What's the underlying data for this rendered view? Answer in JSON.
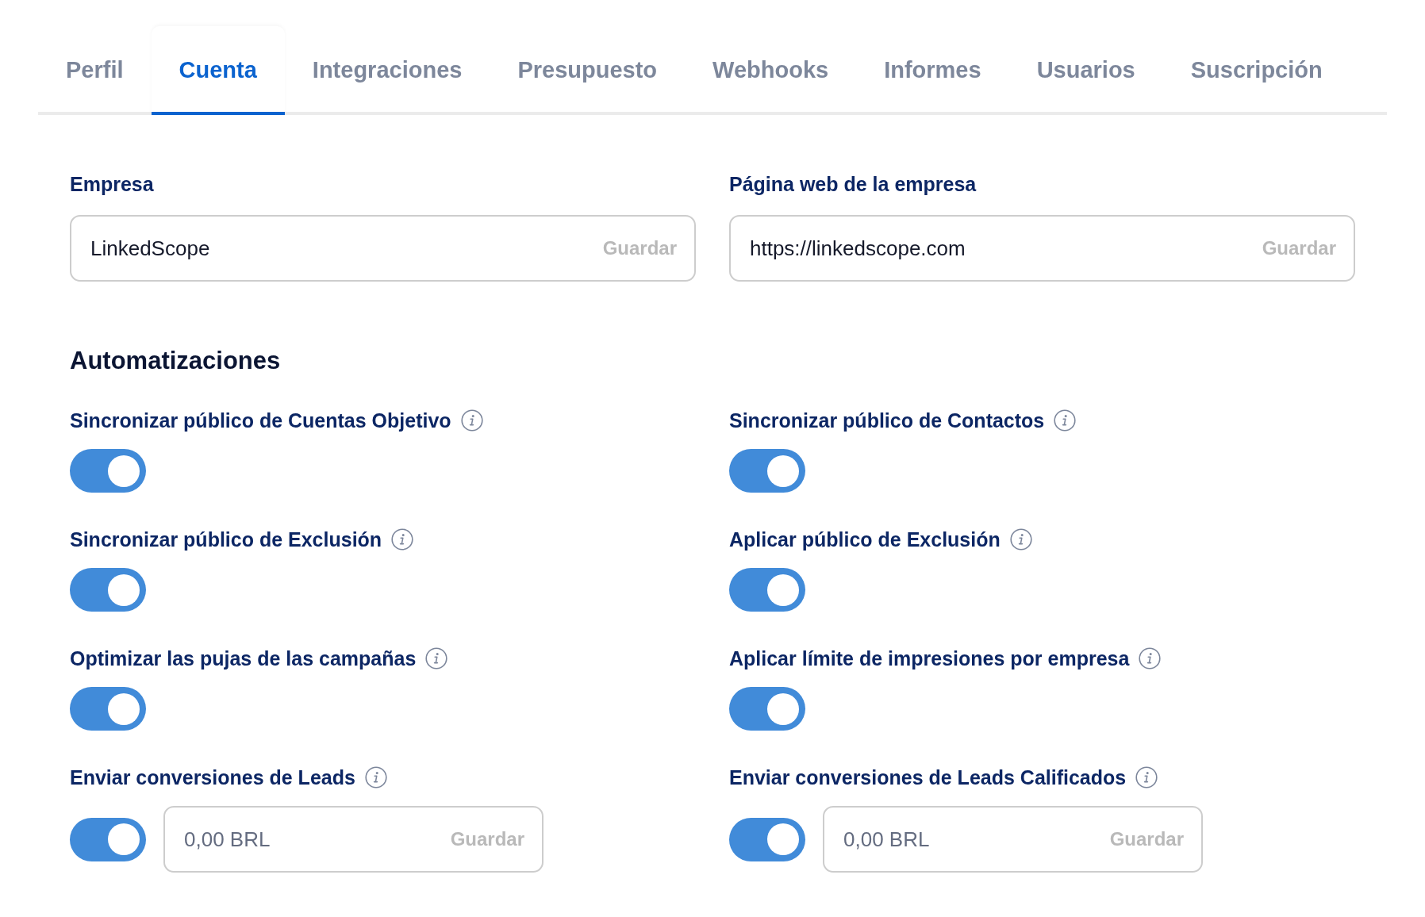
{
  "tabs": [
    {
      "label": "Perfil",
      "selected": false
    },
    {
      "label": "Cuenta",
      "selected": true
    },
    {
      "label": "Integraciones",
      "selected": false
    },
    {
      "label": "Presupuesto",
      "selected": false
    },
    {
      "label": "Webhooks",
      "selected": false
    },
    {
      "label": "Informes",
      "selected": false
    },
    {
      "label": "Usuarios",
      "selected": false
    },
    {
      "label": "Suscripción",
      "selected": false
    }
  ],
  "company_fields": [
    {
      "label": "Empresa",
      "value": "LinkedScope",
      "save_button": {
        "label": "Guardar",
        "disabled": true
      }
    },
    {
      "label": "Página web de la empresa",
      "value": "https://linkedscope.com",
      "save_button": {
        "label": "Guardar",
        "disabled": true
      }
    }
  ],
  "automations": {
    "title": "Automatizaciones",
    "items": [
      {
        "kind": "toggle",
        "label": "Sincronizar público de Cuentas Objetivo",
        "on": true
      },
      {
        "kind": "toggle",
        "label": "Sincronizar público de Contactos",
        "on": true
      },
      {
        "kind": "toggle",
        "label": "Sincronizar público de Exclusión",
        "on": true
      },
      {
        "kind": "toggle",
        "label": "Aplicar público de Exclusión",
        "on": true
      },
      {
        "kind": "toggle",
        "label": "Optimizar las pujas de las campañas",
        "on": true
      },
      {
        "kind": "toggle",
        "label": "Aplicar límite de impresiones por empresa",
        "on": true
      },
      {
        "kind": "toggle_amount",
        "label": "Enviar conversiones de Leads",
        "on": true,
        "amount": {
          "placeholder": "0,00 BRL",
          "save_button": {
            "label": "Guardar",
            "disabled": true
          }
        }
      },
      {
        "kind": "toggle_amount",
        "label": "Enviar conversiones de Leads Calificados",
        "on": true,
        "amount": {
          "placeholder": "0,00 BRL",
          "save_button": {
            "label": "Guardar",
            "disabled": true
          }
        }
      }
    ]
  }
}
